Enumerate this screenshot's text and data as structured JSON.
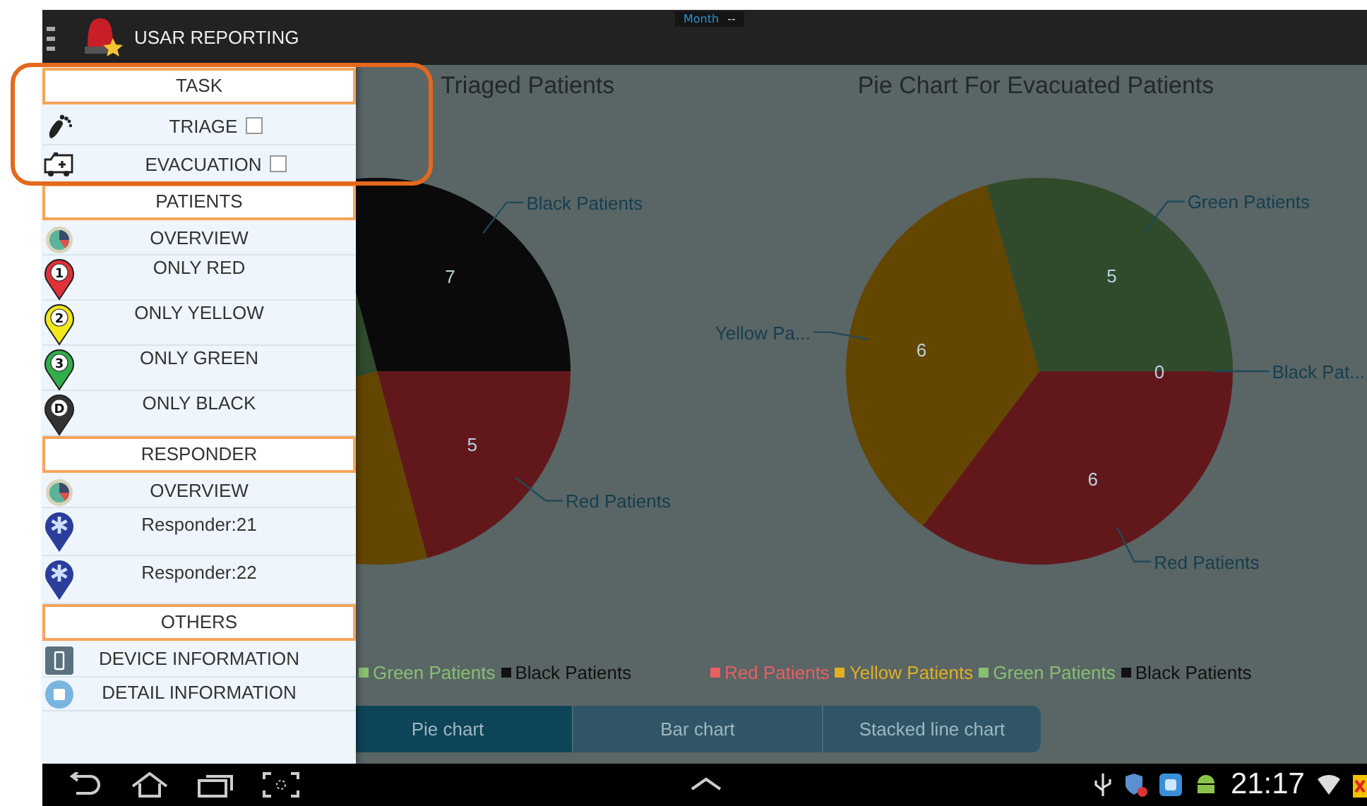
{
  "app_bar": {
    "title": "USAR REPORTING",
    "period": "Month",
    "period_value": "--"
  },
  "drawer": {
    "sections": [
      {
        "title": "TASK",
        "items": [
          {
            "kind": "triage",
            "label": "TRIAGE",
            "checked": false
          },
          {
            "kind": "evacuation",
            "label": "EVACUATION",
            "checked": false
          }
        ]
      },
      {
        "title": "PATIENTS",
        "items": [
          {
            "kind": "overview",
            "label": "OVERVIEW"
          },
          {
            "kind": "pin",
            "label": "ONLY RED",
            "pin_text": "1",
            "color": "#e0303a"
          },
          {
            "kind": "pin",
            "label": "ONLY YELLOW",
            "pin_text": "2",
            "color": "#f2e81c"
          },
          {
            "kind": "pin",
            "label": "ONLY GREEN",
            "pin_text": "3",
            "color": "#2fae4a"
          },
          {
            "kind": "pin",
            "label": "ONLY BLACK",
            "pin_text": "D",
            "color": "#333333"
          }
        ]
      },
      {
        "title": "RESPONDER",
        "items": [
          {
            "kind": "overview",
            "label": "OVERVIEW"
          },
          {
            "kind": "responder",
            "label": "Responder:21"
          },
          {
            "kind": "responder",
            "label": "Responder:22"
          }
        ]
      },
      {
        "title": "OTHERS",
        "items": [
          {
            "kind": "device",
            "label": "DEVICE INFORMATION"
          },
          {
            "kind": "detail",
            "label": "DETAIL INFORMATION"
          }
        ]
      }
    ]
  },
  "charts": [
    {
      "title": "Triaged Patients",
      "value_labels": [
        "7",
        "5"
      ],
      "callouts": [
        "Black Patients",
        "Red Patients"
      ],
      "legend": [
        {
          "label": "Green Patients",
          "color": "#86c070"
        },
        {
          "label": "Black Patients",
          "color": "#111111"
        }
      ]
    },
    {
      "title": "Pie Chart For Evacuated Patients",
      "chart_data": {
        "type": "pie",
        "categories": [
          "Red Patients",
          "Yellow Pa...",
          "Green Patients",
          "Black Pat..."
        ],
        "values": [
          6,
          6,
          5,
          0
        ],
        "colors": [
          "#62181b",
          "#634600",
          "#2f4b2b",
          "#0a0a0a"
        ],
        "value_labels": [
          "6",
          "6",
          "5",
          "0"
        ]
      },
      "legend": [
        {
          "label": "Red Patients",
          "color": "#e86060"
        },
        {
          "label": "Yellow Patients",
          "color": "#e0b020"
        },
        {
          "label": "Green Patients",
          "color": "#86c070"
        },
        {
          "label": "Black Patients",
          "color": "#111111"
        }
      ]
    }
  ],
  "chart_tabs": [
    {
      "label": "Pie chart",
      "selected": true
    },
    {
      "label": "Bar chart",
      "selected": false
    },
    {
      "label": "Stacked line chart",
      "selected": false
    }
  ],
  "nav_bar": {
    "time": "21:17"
  }
}
